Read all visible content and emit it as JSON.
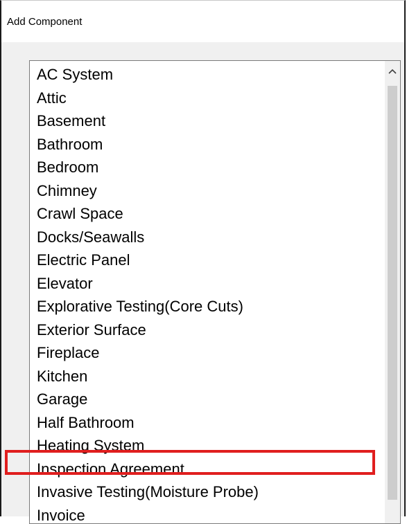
{
  "window": {
    "title": "Add Component"
  },
  "list": {
    "items": [
      {
        "label": "AC System"
      },
      {
        "label": "Attic"
      },
      {
        "label": "Basement"
      },
      {
        "label": "Bathroom"
      },
      {
        "label": "Bedroom"
      },
      {
        "label": "Chimney"
      },
      {
        "label": "Crawl Space"
      },
      {
        "label": "Docks/Seawalls"
      },
      {
        "label": "Electric Panel"
      },
      {
        "label": "Elevator"
      },
      {
        "label": "Explorative Testing(Core Cuts)"
      },
      {
        "label": "Exterior Surface"
      },
      {
        "label": "Fireplace"
      },
      {
        "label": "Kitchen"
      },
      {
        "label": "Garage"
      },
      {
        "label": "Half Bathroom"
      },
      {
        "label": "Heating System"
      },
      {
        "label": "Inspection Agreement"
      },
      {
        "label": "Invasive Testing(Moisture Probe)"
      },
      {
        "label": "Invoice"
      }
    ],
    "highlighted_item": "Inspection Agreement"
  },
  "icons": {
    "scroll_up": "chevron-up-icon"
  },
  "colors": {
    "highlight_border": "#e01e1e",
    "scroll_thumb": "#cdcdcd",
    "list_background": "#ffffff"
  }
}
